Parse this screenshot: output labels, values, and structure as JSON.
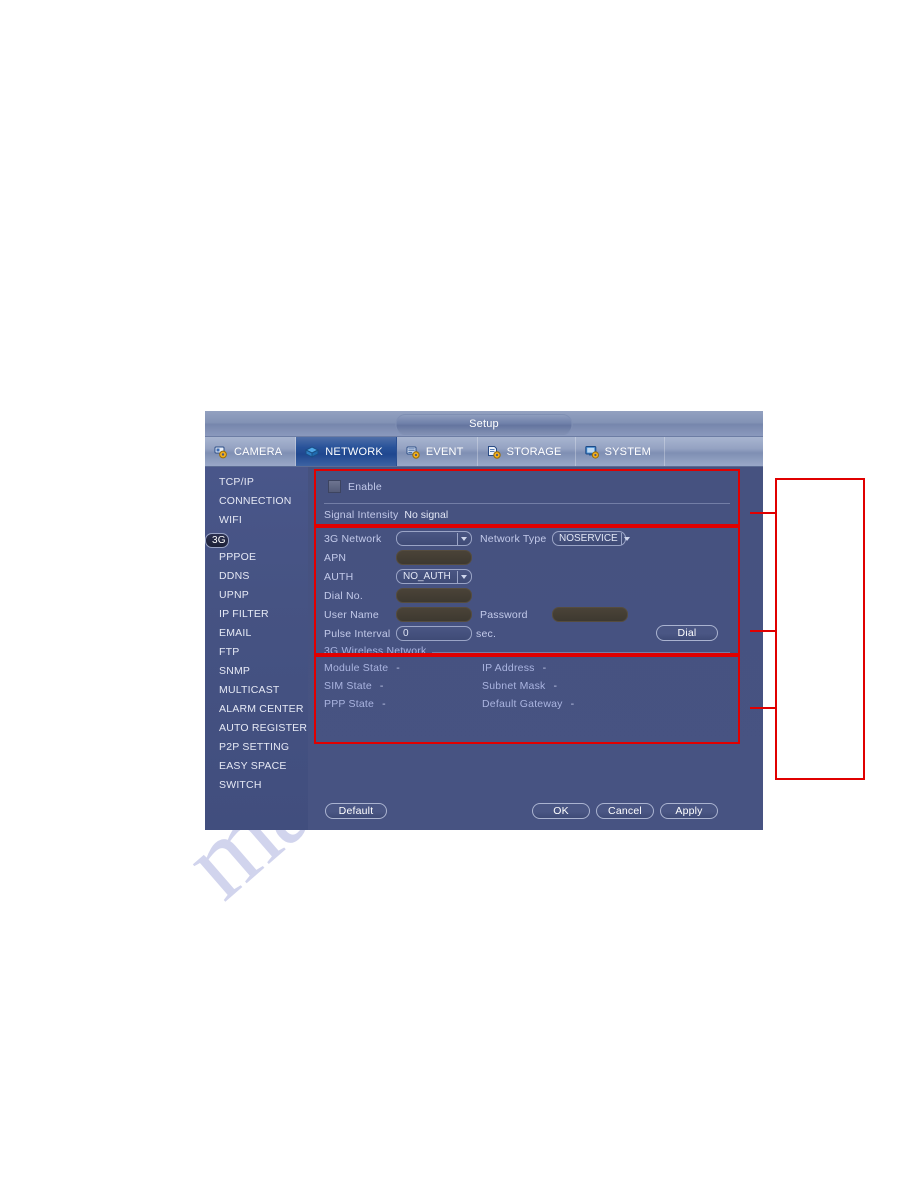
{
  "window": {
    "title": "Setup"
  },
  "tabs": [
    {
      "label": "CAMERA",
      "icon": "camera-gear-icon",
      "active": false
    },
    {
      "label": "NETWORK",
      "icon": "network-icon",
      "active": true
    },
    {
      "label": "EVENT",
      "icon": "event-gear-icon",
      "active": false
    },
    {
      "label": "STORAGE",
      "icon": "storage-gear-icon",
      "active": false
    },
    {
      "label": "SYSTEM",
      "icon": "system-gear-icon",
      "active": false
    }
  ],
  "sidebar": {
    "items": [
      {
        "label": "TCP/IP",
        "selected": false
      },
      {
        "label": "CONNECTION",
        "selected": false
      },
      {
        "label": "WIFI",
        "selected": false
      },
      {
        "label": "3G",
        "selected": true
      },
      {
        "label": "PPPOE",
        "selected": false
      },
      {
        "label": "DDNS",
        "selected": false
      },
      {
        "label": "UPNP",
        "selected": false
      },
      {
        "label": "IP FILTER",
        "selected": false
      },
      {
        "label": "EMAIL",
        "selected": false
      },
      {
        "label": "FTP",
        "selected": false
      },
      {
        "label": "SNMP",
        "selected": false
      },
      {
        "label": "MULTICAST",
        "selected": false
      },
      {
        "label": "ALARM CENTER",
        "selected": false
      },
      {
        "label": "AUTO REGISTER",
        "selected": false
      },
      {
        "label": "P2P SETTING",
        "selected": false
      },
      {
        "label": "EASY SPACE",
        "selected": false
      },
      {
        "label": "SWITCH",
        "selected": false
      }
    ]
  },
  "section_enable": {
    "enable_label": "Enable",
    "enable_checked": false,
    "signal_intensity_label": "Signal Intensity",
    "signal_intensity_value": "No signal"
  },
  "section_config": {
    "network_label": "3G Network",
    "network_value": "",
    "network_type_label": "Network Type",
    "network_type_value": "NOSERVICE",
    "apn_label": "APN",
    "apn_value": "",
    "auth_label": "AUTH",
    "auth_value": "NO_AUTH",
    "dial_no_label": "Dial No.",
    "dial_no_value": "",
    "user_name_label": "User Name",
    "user_name_value": "",
    "password_label": "Password",
    "password_value": "",
    "pulse_interval_label": "Pulse Interval",
    "pulse_interval_value": "0",
    "pulse_interval_unit": "sec.",
    "dial_button": "Dial",
    "group_label": "3G Wireless Network"
  },
  "section_status": {
    "module_state_label": "Module State",
    "module_state_value": "-",
    "sim_state_label": "SIM State",
    "sim_state_value": "-",
    "ppp_state_label": "PPP State",
    "ppp_state_value": "-",
    "ip_address_label": "IP Address",
    "ip_address_value": "-",
    "subnet_mask_label": "Subnet Mask",
    "subnet_mask_value": "-",
    "default_gateway_label": "Default Gateway",
    "default_gateway_value": "-"
  },
  "footer": {
    "default_label": "Default",
    "ok_label": "OK",
    "cancel_label": "Cancel",
    "apply_label": "Apply"
  },
  "watermark": {
    "text": "manualslib.com"
  },
  "colors": {
    "annotation": "#e00000",
    "tab_active": "#29539a",
    "sidebar": "#465383",
    "panel": "#465280"
  }
}
